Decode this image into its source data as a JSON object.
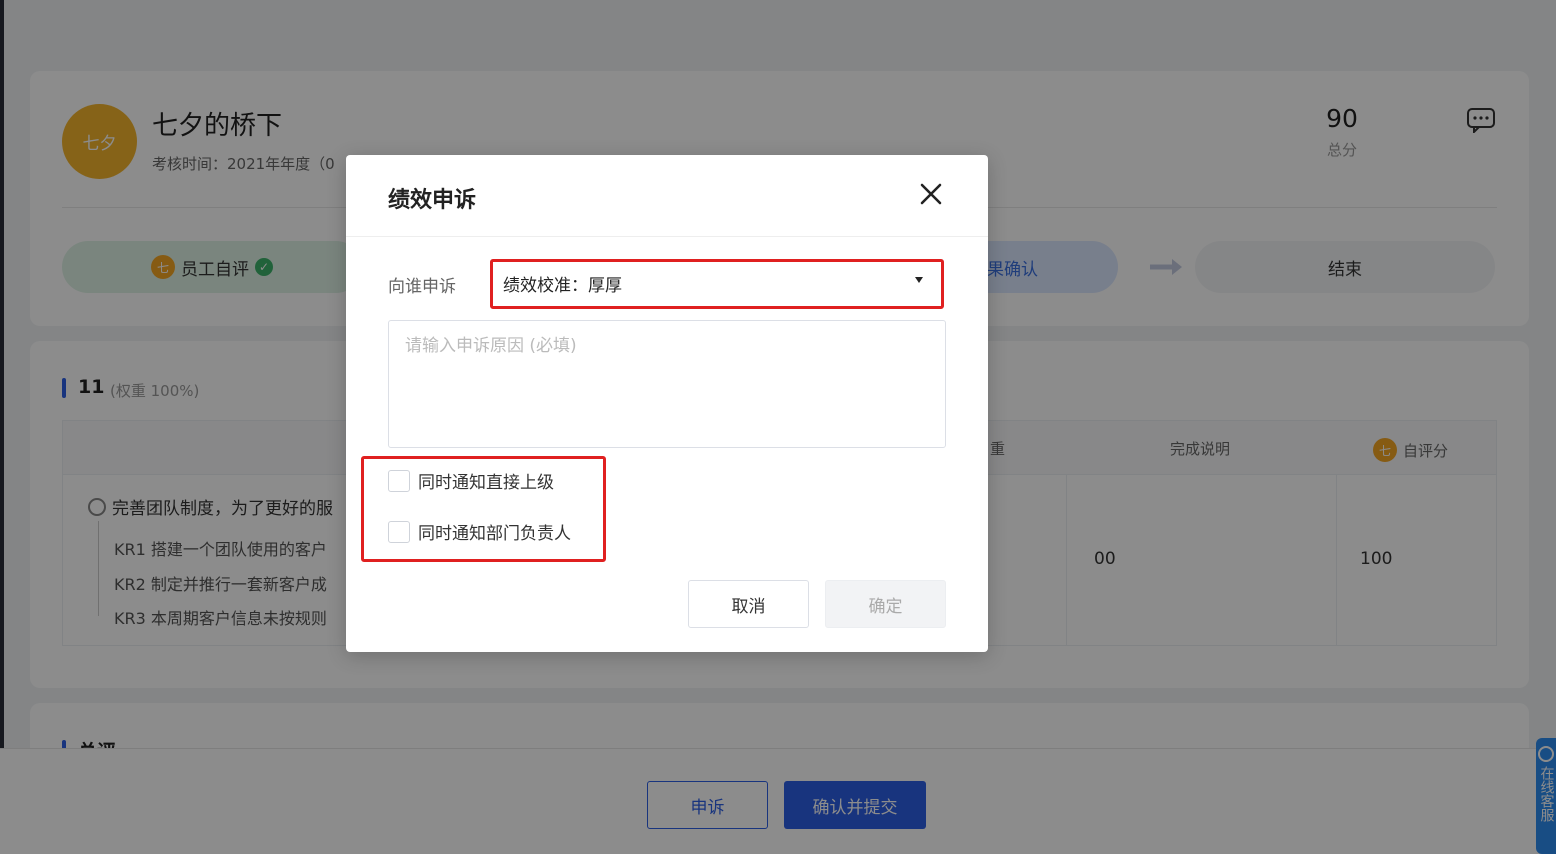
{
  "profile": {
    "avatar_text": "七夕",
    "name": "七夕的桥下",
    "period": "考核时间：2021年年度（0",
    "total_score": "90",
    "total_label": "总分"
  },
  "steps": [
    {
      "num": "七",
      "label": "员工自评",
      "status": "done"
    },
    {
      "label": "果确认",
      "status": "current"
    },
    {
      "label": "结束",
      "status": "pending"
    }
  ],
  "section": {
    "title": "11",
    "weight": "(权重 100%)",
    "columns": {
      "weight": "重",
      "desc": "完成说明",
      "self_num": "七",
      "self": "自评分"
    },
    "goal": "完善团队制度，为了更好的服",
    "krs": [
      "KR1 搭建一个团队使用的客户",
      "KR2 制定并推行一套新客户成",
      "KR3 本周期客户信息未按规则"
    ],
    "values": {
      "desc": "00",
      "self": "100"
    }
  },
  "summary": {
    "title": "总评"
  },
  "footer": {
    "appeal_label": "申诉",
    "confirm_label": "确认并提交"
  },
  "side_service": {
    "label": "在线客服"
  },
  "modal": {
    "title": "绩效申诉",
    "target_label": "向谁申诉",
    "target_value": "绩效校准：厚厚",
    "reason_placeholder": "请输入申诉原因 (必填)",
    "notify_manager": "同时通知直接上级",
    "notify_dept_head": "同时通知部门负责人",
    "cancel_label": "取消",
    "ok_label": "确定"
  },
  "colors": {
    "primary": "#2d5fe6",
    "highlight": "#e02020",
    "avatar": "#f5b52d"
  },
  "icons": [
    "chat-icon",
    "check-circle-icon",
    "arrow-right-icon",
    "goal-icon",
    "close-icon",
    "dropdown-caret-icon"
  ]
}
